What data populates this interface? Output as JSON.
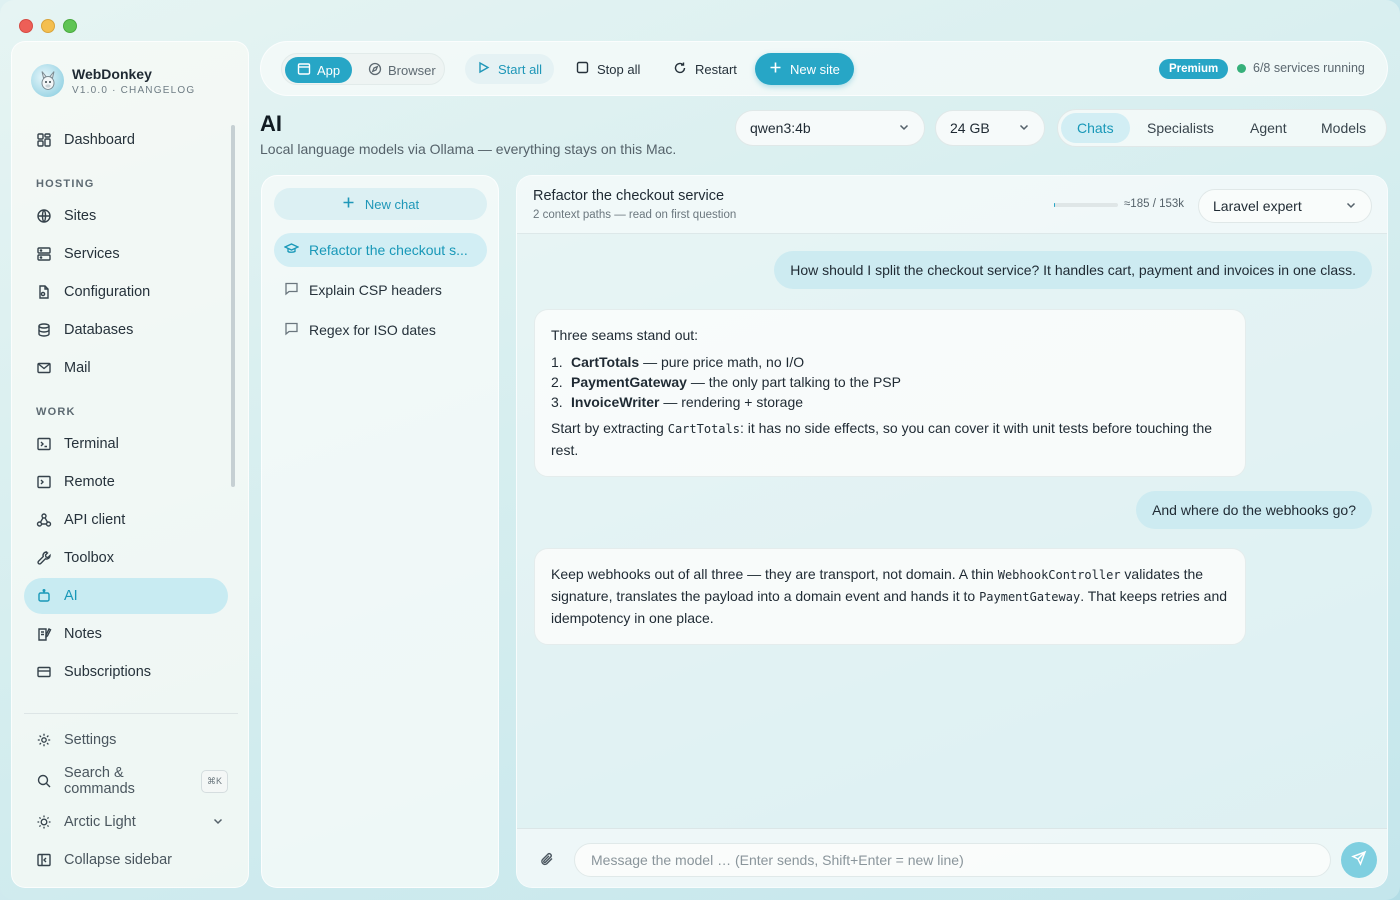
{
  "app": {
    "name": "WebDonkey",
    "version": "V1.0.0 · CHANGELOG"
  },
  "sidebar": {
    "top_item": "Dashboard",
    "sections": {
      "hosting": "HOSTING",
      "work": "WORK"
    },
    "hosting_items": [
      "Sites",
      "Services",
      "Configuration",
      "Databases",
      "Mail"
    ],
    "work_items": [
      "Terminal",
      "Remote",
      "API client",
      "Toolbox",
      "AI",
      "Notes",
      "Subscriptions"
    ],
    "active_item": "AI",
    "settings": "Settings",
    "search": "Search & commands",
    "search_shortcut": "⌘K",
    "theme": "Arctic Light",
    "collapse": "Collapse sidebar"
  },
  "toolbar": {
    "app": "App",
    "browser": "Browser",
    "start_all": "Start all",
    "stop_all": "Stop all",
    "restart": "Restart",
    "new_site": "New site",
    "premium": "Premium",
    "services_status": "6/8 services running",
    "status_color": "#36b07a"
  },
  "page": {
    "title": "AI",
    "subtitle": "Local language models via Ollama — everything stays on this Mac.",
    "model_select": "qwen3:4b",
    "ram_select": "24 GB",
    "tabs": [
      "Chats",
      "Specialists",
      "Agent",
      "Models"
    ],
    "active_tab": "Chats"
  },
  "chats": {
    "new_chat": "New chat",
    "items": [
      "Refactor the checkout s...",
      "Explain CSP headers",
      "Regex for ISO dates"
    ]
  },
  "conversation": {
    "title": "Refactor the checkout service",
    "subtitle": "2 context paths — read on first question",
    "context_usage": "≈185 / 153k",
    "context_fraction": 0.0012,
    "specialist": "Laravel expert",
    "messages": {
      "user1": "How should I split the checkout service? It handles cart, payment and invoices in one class.",
      "ai1": {
        "intro": "Three seams stand out:",
        "items": [
          {
            "num": "1.",
            "name": "CartTotals",
            "desc": " — pure price math, no I/O"
          },
          {
            "num": "2.",
            "name": "PaymentGateway",
            "desc": " — the only part talking to the PSP"
          },
          {
            "num": "3.",
            "name": "InvoiceWriter",
            "desc": " — rendering + storage"
          }
        ],
        "outro_pre": "Start by extracting ",
        "outro_code": "CartTotals",
        "outro_post": ": it has no side effects, so you can cover it with unit tests before touching the rest."
      },
      "user2": "And where do the webhooks go?",
      "ai2": {
        "p1": "Keep webhooks out of all three — they are transport, not domain. A thin ",
        "code1": "WebhookController",
        "p2": " validates the signature, translates the payload into a domain event and hands it to ",
        "code2": "PaymentGateway",
        "p3": ". That keeps retries and idempotency in one place."
      }
    },
    "composer_placeholder": "Message the model … (Enter sends, Shift+Enter = new line)",
    "composer_value": ""
  },
  "colors": {
    "accent": "#27a6c6",
    "active_bg": "#c8ebf2"
  }
}
